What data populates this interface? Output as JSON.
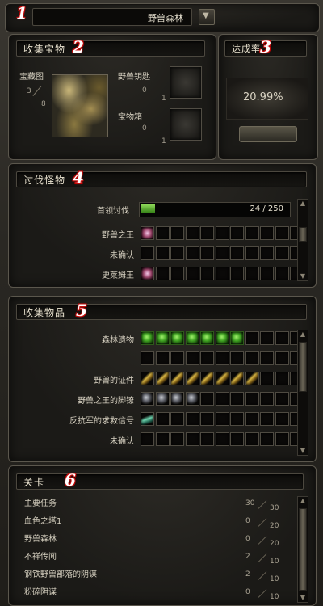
{
  "header": {
    "location": "野兽森林",
    "badge": "1"
  },
  "treasure": {
    "title": "收集宝物",
    "badge": "2",
    "map_label": "宝藏图",
    "map_have": "3",
    "map_need": "8",
    "key_label": "野兽钥匙",
    "key_have": "0",
    "key_need": "1",
    "chest_label": "宝物箱",
    "chest_have": "0",
    "chest_need": "1"
  },
  "rate": {
    "title": "达成率",
    "badge": "3",
    "value": "20.99%"
  },
  "hunt": {
    "title": "讨伐怪物",
    "badge": "4",
    "progress_label": "首领讨伐",
    "progress_text": "24 / 250",
    "progress": 0.096,
    "rows": [
      {
        "label": "野兽之王",
        "slots": [
          "pink",
          "",
          "",
          "",
          "",
          "",
          "",
          "",
          "",
          "",
          ""
        ]
      },
      {
        "label": "未确认",
        "slots": [
          "",
          "",
          "",
          "",
          "",
          "",
          "",
          "",
          "",
          "",
          ""
        ]
      },
      {
        "label": "史莱姆王",
        "slots": [
          "pink",
          "",
          "",
          "",
          "",
          "",
          "",
          "",
          "",
          "",
          ""
        ]
      }
    ]
  },
  "items": {
    "title": "收集物品",
    "badge": "5",
    "rows": [
      {
        "label": "森林遗物",
        "slots": [
          "green",
          "green",
          "green",
          "green",
          "green",
          "green",
          "green",
          "",
          "",
          "",
          ""
        ]
      },
      {
        "label": "",
        "slots": [
          "",
          "",
          "",
          "",
          "",
          "",
          "",
          "",
          "",
          "",
          ""
        ]
      },
      {
        "label": "野兽的证件",
        "slots": [
          "gold",
          "gold",
          "gold",
          "gold",
          "gold",
          "gold",
          "gold",
          "gold",
          "",
          "",
          ""
        ]
      },
      {
        "label": "野兽之王的脚镣",
        "slots": [
          "grey",
          "grey",
          "grey",
          "grey",
          "",
          "",
          "",
          "",
          "",
          "",
          ""
        ]
      },
      {
        "label": "反抗军的求救信号",
        "slots": [
          "teal",
          "",
          "",
          "",
          "",
          "",
          "",
          "",
          "",
          "",
          ""
        ]
      },
      {
        "label": "未确认",
        "slots": [
          "",
          "",
          "",
          "",
          "",
          "",
          "",
          "",
          "",
          "",
          ""
        ]
      }
    ]
  },
  "stages": {
    "title": "关卡",
    "badge": "6",
    "rows": [
      {
        "label": "主要任务",
        "have": "30",
        "need": "30"
      },
      {
        "label": "血色之塔1",
        "have": "0",
        "need": "20"
      },
      {
        "label": "野兽森林",
        "have": "0",
        "need": "20"
      },
      {
        "label": "不祥传闻",
        "have": "2",
        "need": "10"
      },
      {
        "label": "钢铁野兽部落的阴谋",
        "have": "2",
        "need": "10"
      },
      {
        "label": "粉碎阴谋",
        "have": "0",
        "need": "10"
      }
    ]
  }
}
